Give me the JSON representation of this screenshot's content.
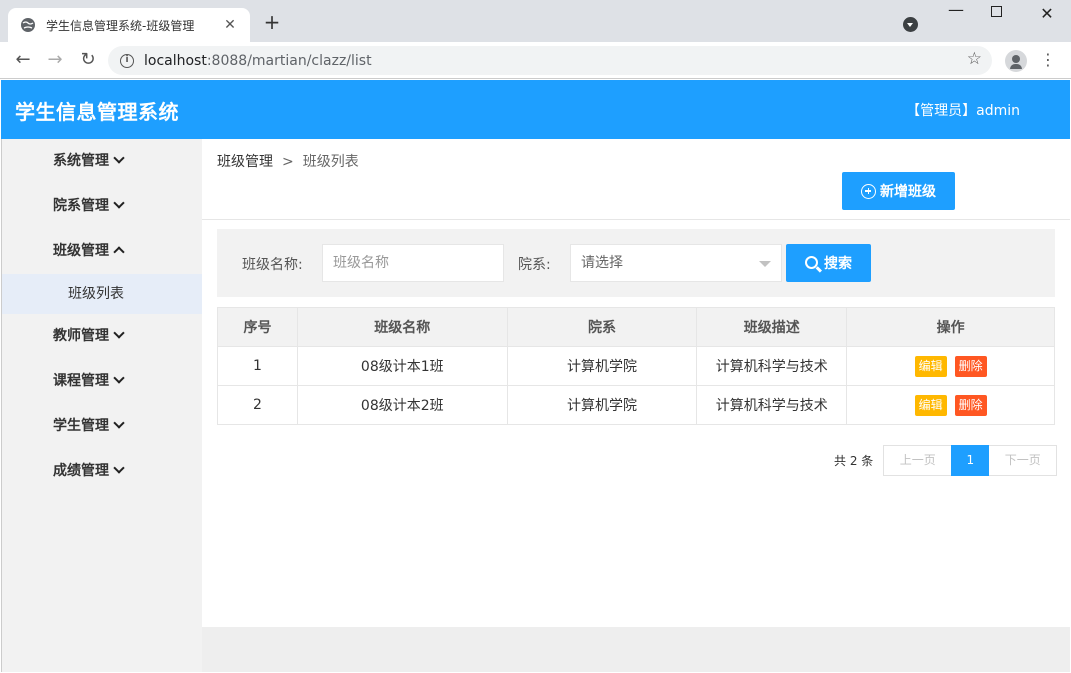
{
  "browser": {
    "tab_title": "学生信息管理系统-班级管理",
    "tab_close": "✕",
    "new_tab": "+",
    "url_host": "localhost",
    "url_path": ":8088/martian/clazz/list"
  },
  "header": {
    "title": "学生信息管理系统",
    "user": "【管理员】admin"
  },
  "sidebar": {
    "items": [
      {
        "label": "系统管理",
        "expanded": false
      },
      {
        "label": "院系管理",
        "expanded": false
      },
      {
        "label": "班级管理",
        "expanded": true
      },
      {
        "label": "教师管理",
        "expanded": false
      },
      {
        "label": "课程管理",
        "expanded": false
      },
      {
        "label": "学生管理",
        "expanded": false
      },
      {
        "label": "成绩管理",
        "expanded": false
      }
    ],
    "sub_item": "班级列表"
  },
  "breadcrumb": {
    "parent": "班级管理",
    "sep": ">",
    "current": "班级列表"
  },
  "toolbar": {
    "add_label": "新增班级"
  },
  "filter": {
    "name_label": "班级名称:",
    "name_placeholder": "班级名称",
    "dept_label": "院系:",
    "dept_value": "请选择",
    "search_label": "搜索"
  },
  "table": {
    "headers": [
      "序号",
      "班级名称",
      "院系",
      "班级描述",
      "操作"
    ],
    "rows": [
      [
        "1",
        "08级计本1班",
        "计算机学院",
        "计算机科学与技术"
      ],
      [
        "2",
        "08级计本2班",
        "计算机学院",
        "计算机科学与技术"
      ]
    ],
    "edit_label": "编辑",
    "delete_label": "删除"
  },
  "pager": {
    "total": "共 2 条",
    "prev": "上一页",
    "current": "1",
    "next": "下一页"
  },
  "colors": {
    "accent": "#1e9fff",
    "edit": "#ffb800",
    "delete": "#ff5722"
  }
}
